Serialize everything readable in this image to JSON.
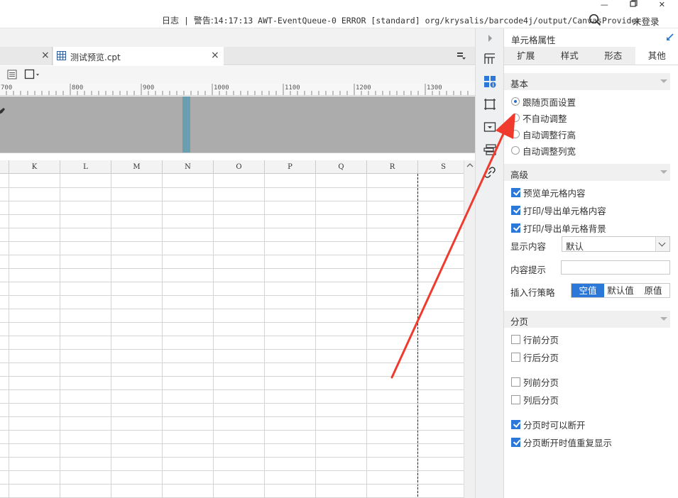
{
  "titlebar": {
    "log_label": "日志",
    "warn_label": "警告:",
    "log_message": "14:17:13 AWT-EventQueue-0 ERROR [standard] org/krysalis/barcode4j/output/CanvasProvider",
    "login_label": "未登录"
  },
  "tabs": [
    {
      "label": "",
      "closable": true
    },
    {
      "label": "测试预览.cpt",
      "closable": true,
      "active": true
    }
  ],
  "close_glyph": "×",
  "ruler": {
    "labels": [
      "700",
      "800",
      "900",
      "1000",
      "1100",
      "1200",
      "1300"
    ]
  },
  "sheet": {
    "columns": [
      "K",
      "L",
      "M",
      "N",
      "O",
      "P",
      "Q",
      "R",
      "S"
    ]
  },
  "icons": {
    "strip": [
      "expand-arrow-icon",
      "cell-element-icon",
      "cell-attribute-icon",
      "floating-element-icon",
      "widget-icon",
      "report-block-icon",
      "hyperlink-icon"
    ]
  },
  "panel": {
    "title": "单元格属性",
    "tabs": [
      "扩展",
      "样式",
      "形态",
      "其他"
    ],
    "active_tab": "其他",
    "sections": {
      "basic": {
        "title": "基本",
        "options": [
          {
            "label": "跟随页面设置",
            "selected": true
          },
          {
            "label": "不自动调整",
            "selected": false
          },
          {
            "label": "自动调整行高",
            "selected": false
          },
          {
            "label": "自动调整列宽",
            "selected": false
          }
        ]
      },
      "advanced": {
        "title": "高级",
        "checks": [
          {
            "label": "预览单元格内容",
            "checked": true
          },
          {
            "label": "打印/导出单元格内容",
            "checked": true
          },
          {
            "label": "打印/导出单元格背景",
            "checked": true
          }
        ],
        "display_label": "显示内容",
        "display_value": "默认",
        "tip_label": "内容提示",
        "tip_value": "",
        "insert_label": "插入行策略",
        "insert_options": [
          "空值",
          "默认值",
          "原值"
        ],
        "insert_selected": "空值"
      },
      "paging": {
        "title": "分页",
        "checks": [
          {
            "label": "行前分页",
            "checked": false
          },
          {
            "label": "行后分页",
            "checked": false
          },
          {
            "label": "列前分页",
            "checked": false
          },
          {
            "label": "列后分页",
            "checked": false
          },
          {
            "label": "分页时可以断开",
            "checked": true
          },
          {
            "label": "分页断开时值重复显示",
            "checked": true
          }
        ]
      }
    }
  },
  "colors": {
    "accent": "#2b78d8",
    "annotation": "#f03a2e",
    "preview_marker": "#6a9fb2"
  }
}
